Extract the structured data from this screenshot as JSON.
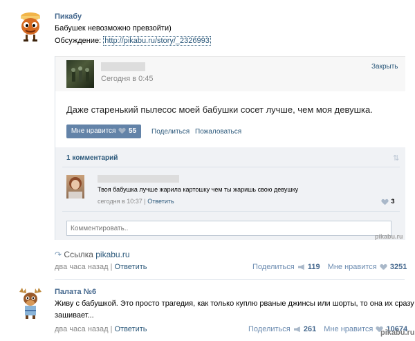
{
  "post1": {
    "author": "Пикабу",
    "text": "Бабушек невозможно превзойти)",
    "discussion_label": "Обсуждение:",
    "discussion_url": "http://pikabu.ru/story/_2326993",
    "source_label": "Ссылка",
    "source_link": "pikabu.ru",
    "time": "два часа назад",
    "sep": "|",
    "reply": "Ответить",
    "share_label": "Поделиться",
    "share_count": "119",
    "like_label": "Мне нравится",
    "like_count": "3251"
  },
  "embed": {
    "time": "Сегодня в 0:45",
    "close": "Закрыть",
    "text": "Даже старенький пылесос моей бабушки сосет лучше, чем моя девушка.",
    "like_label": "Мне нравится",
    "like_count": "55",
    "share": "Поделиться",
    "report": "Пожаловаться",
    "comments_header": "1 комментарий",
    "comment": {
      "text": "Твоя бабушка лучше жарила картошку чем ты жаришь свою девушку",
      "time": "сегодня в 10:37",
      "sep": "|",
      "reply": "Ответить",
      "likes": "3"
    },
    "comment_input_placeholder": "Комментировать..",
    "watermark": "pikabu.ru"
  },
  "post2": {
    "author": "Палата №6",
    "text_line1": "Живу с бабушкой. Это просто трагедия, как только куплю рваные джинсы или шорты, то она их сразу",
    "text_line2": "зашивает...",
    "time": "два часа назад",
    "sep": "|",
    "reply": "Ответить",
    "share_label": "Поделиться",
    "share_count": "261",
    "like_label": "Мне нравится",
    "like_count": "10674"
  },
  "page_watermark": "pikabu.ru",
  "colors": {
    "link": "#2b587a",
    "author": "#45688e",
    "button": "#6383a8",
    "panel": "#f0f2f5",
    "border": "#dae1e8"
  }
}
